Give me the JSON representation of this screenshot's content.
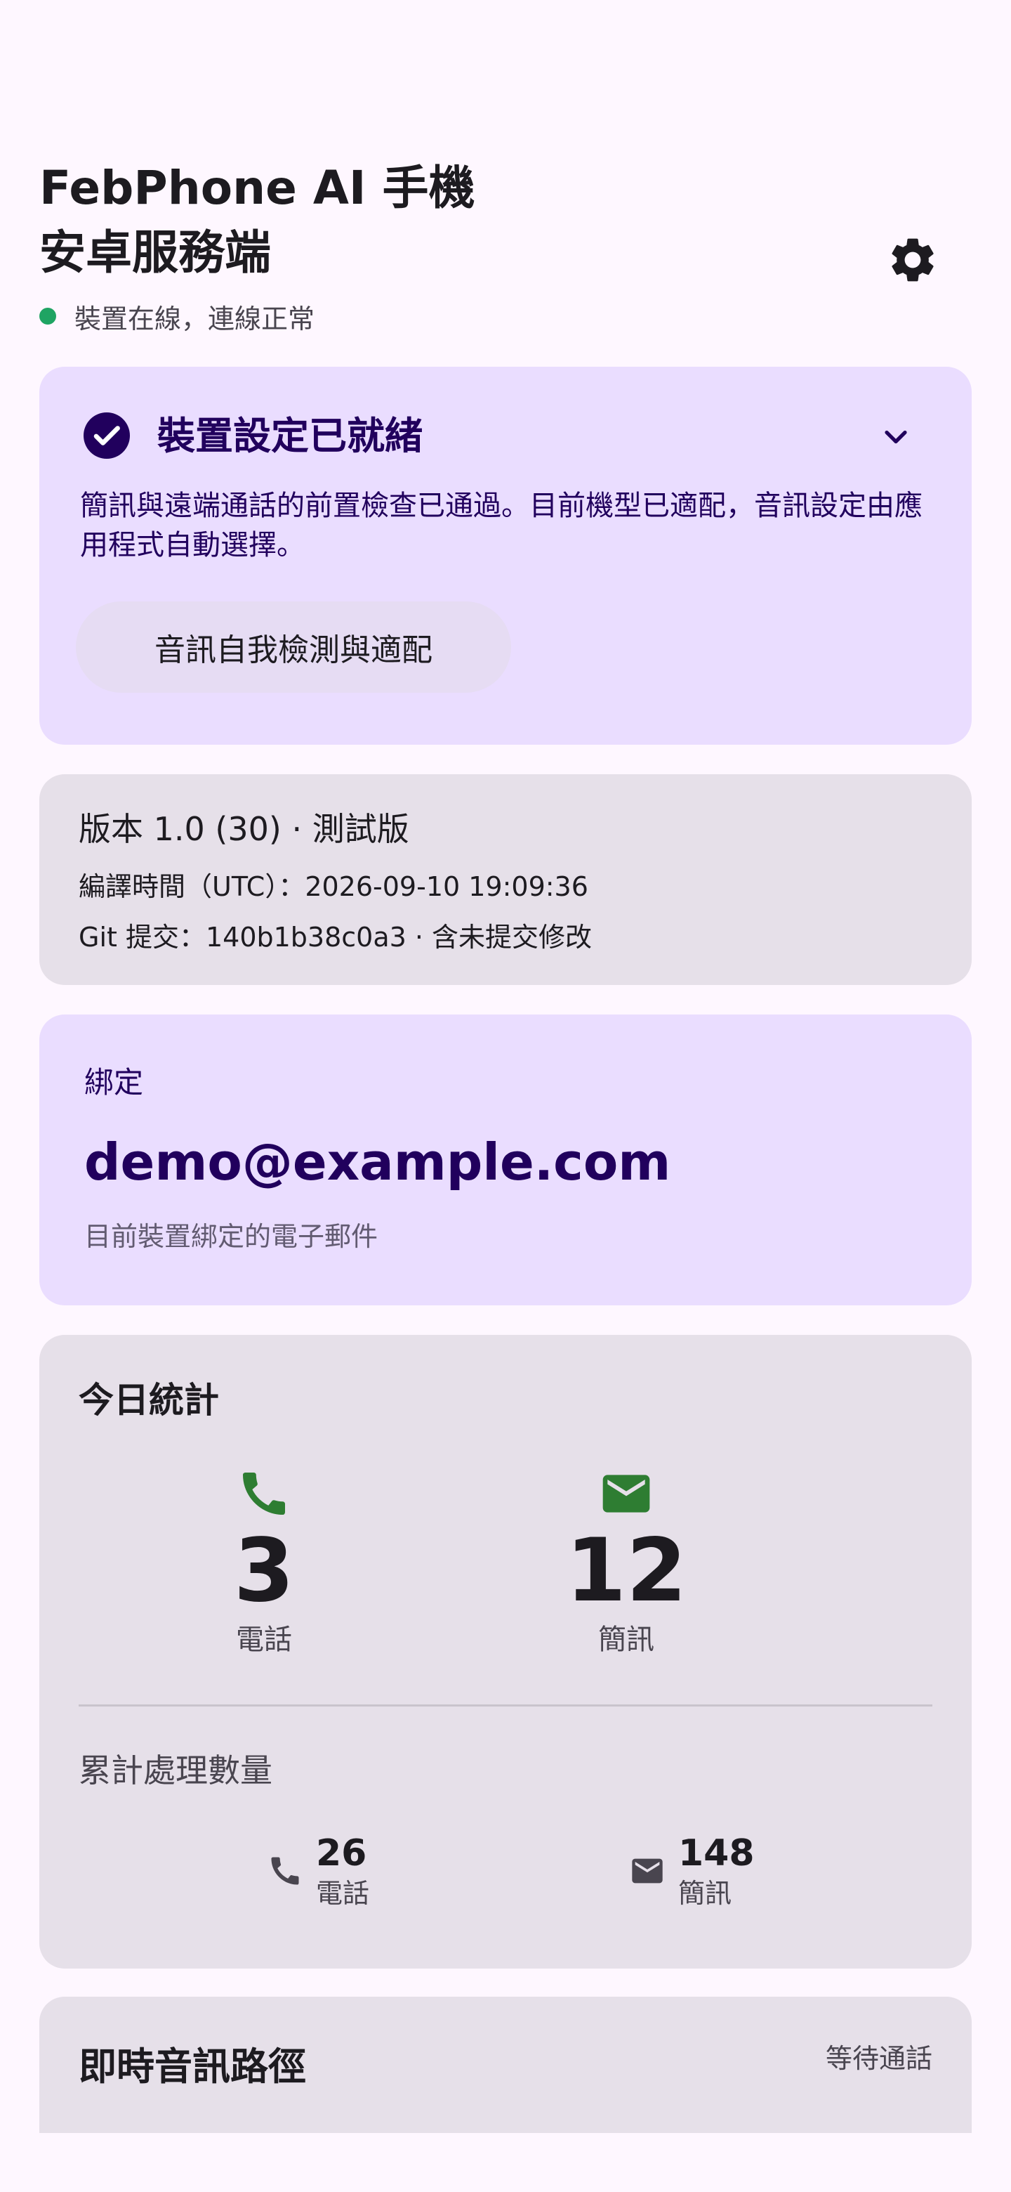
{
  "header": {
    "title_line1": "FebPhone AI 手機",
    "title_line2": "安卓服務端",
    "status_text": "裝置在線，連線正常",
    "status_color": "#1FA463"
  },
  "setup_card": {
    "title": "裝置設定已就緒",
    "description": "簡訊與遠端通話的前置檢查已通過。目前機型已適配，音訊設定由應用程式自動選擇。",
    "selftest_button": "音訊自我檢測與適配",
    "accent_color": "#21005D",
    "icons": {
      "status": "check-circle-icon",
      "expand": "chevron-down-icon"
    }
  },
  "version_card": {
    "title": "版本 1.0 (30) · 測試版",
    "build_time": "編譯時間（UTC）：2026-09-10 19:09:36",
    "git_commit": "Git 提交：140b1b38c0a3 · 含未提交修改"
  },
  "binding_card": {
    "label": "綁定",
    "email": "demo@example.com",
    "caption": "目前裝置綁定的電子郵件"
  },
  "stats_card": {
    "title": "今日統計",
    "today": {
      "calls": {
        "value": "3",
        "label": "電話",
        "icon": "phone-icon",
        "color": "#2E7D32"
      },
      "sms": {
        "value": "12",
        "label": "簡訊",
        "icon": "mail-icon",
        "color": "#2E7D32"
      }
    },
    "total_title": "累計處理數量",
    "total": {
      "calls": {
        "value": "26",
        "label": "電話",
        "icon": "phone-icon"
      },
      "sms": {
        "value": "148",
        "label": "簡訊",
        "icon": "mail-icon"
      }
    }
  },
  "audio_card": {
    "title": "即時音訊路徑",
    "status": "等待通話"
  },
  "settings_icon": "gear-icon"
}
